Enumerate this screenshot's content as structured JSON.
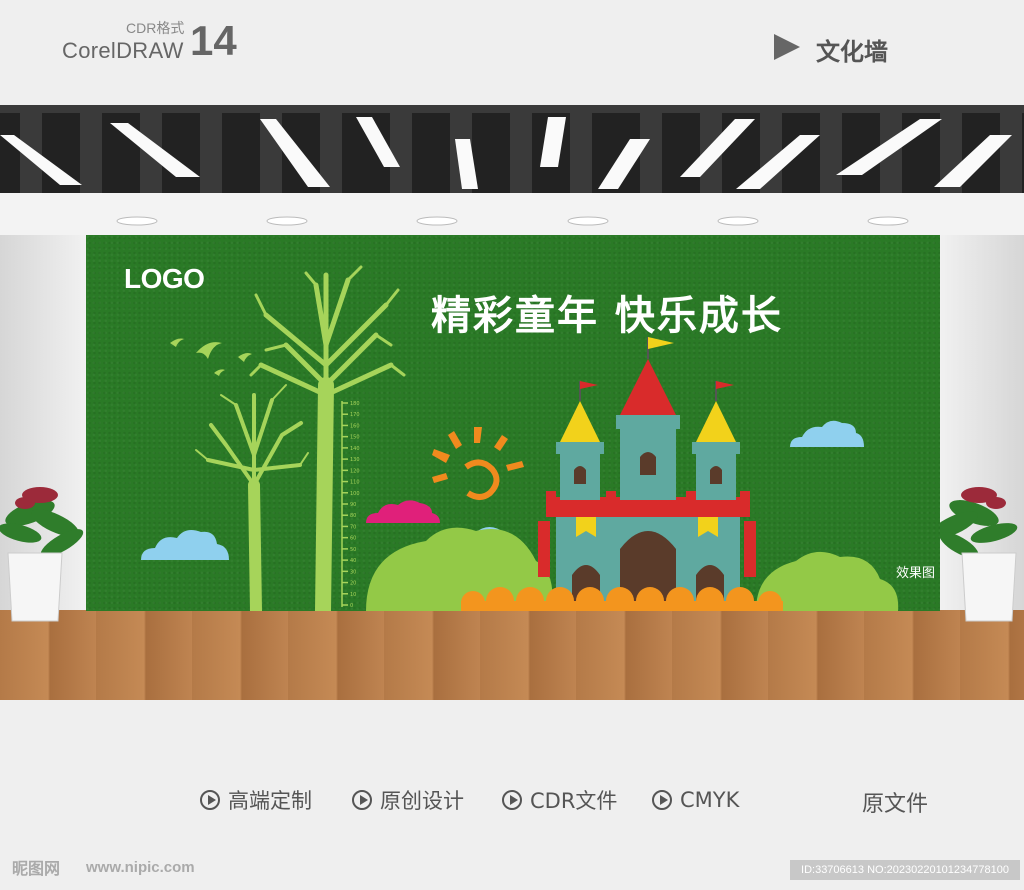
{
  "header": {
    "format_label": "CDR格式",
    "software_name": "CorelDRAW",
    "software_version": "14",
    "category_label": "文化墙"
  },
  "wall": {
    "logo_text": "LOGO",
    "title": "精彩童年 快乐成长",
    "effect_label": "效果图",
    "height_ruler_marks": [
      "0",
      "10",
      "20",
      "30",
      "40",
      "50",
      "60",
      "70",
      "80",
      "90",
      "100",
      "110",
      "120",
      "130",
      "140",
      "150",
      "160",
      "170",
      "180"
    ]
  },
  "footer": {
    "features": [
      "高端定制",
      "原创设计",
      "CDR文件",
      "CMYK"
    ],
    "source_label": "原文件"
  },
  "watermark": {
    "site_logo": "昵图网",
    "url": "www.nipic.com",
    "id_text": "ID:33706613 NO:20230220101234778100"
  },
  "colors": {
    "wall_green": "#2a7a26",
    "tree_green": "#a6d45a",
    "castle_teal": "#5fa9a0",
    "roof_red": "#d92b2b",
    "roof_yellow": "#f2d21b",
    "cloud_blue": "#8fd0ee",
    "cloud_pink": "#e0207a",
    "sun_orange": "#f08a1e",
    "bush_green": "#93c947",
    "ground_orange": "#f3951e"
  }
}
